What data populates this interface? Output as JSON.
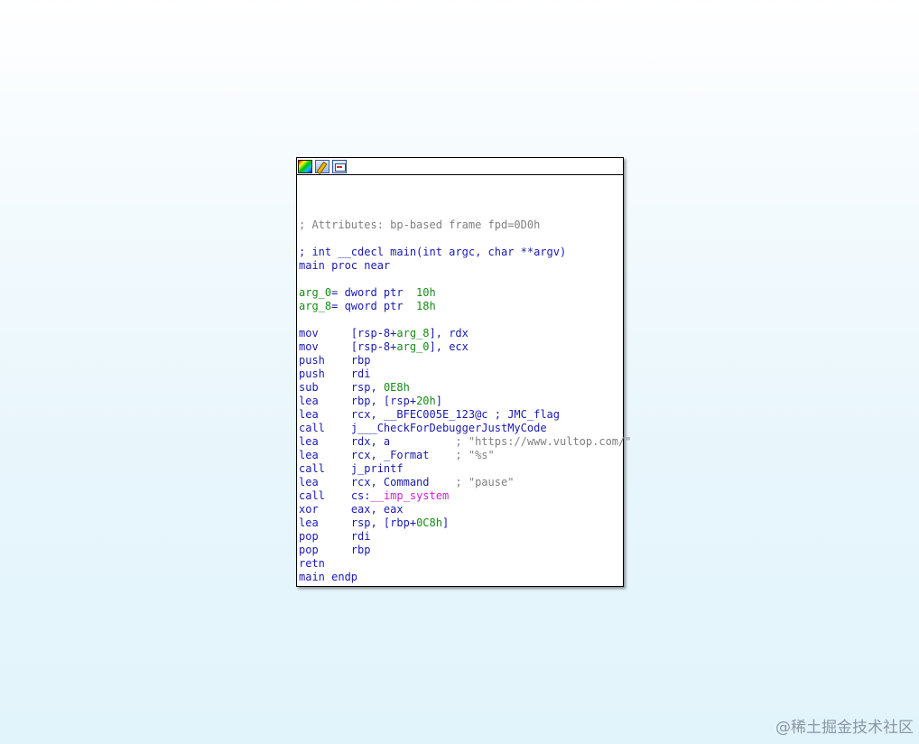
{
  "toolbar": {
    "icons": [
      "color-palette-icon",
      "rename-icon",
      "graph-view-icon"
    ]
  },
  "listing": {
    "attributes": "; Attributes: bp-based frame fpd=0D0h",
    "signature": "; int __cdecl main(int argc, char **argv)",
    "proc_start": "main proc near",
    "arg0_name": "arg_0",
    "arg0_decl": "= dword ptr  ",
    "arg0_val": "10h",
    "arg8_name": "arg_8",
    "arg8_decl": "= qword ptr  ",
    "arg8_val": "18h",
    "instructions": [
      {
        "mnem": "mov",
        "a": "[rsp-8+",
        "b": "arg_8",
        "c": "], rdx"
      },
      {
        "mnem": "mov",
        "a": "[rsp-8+",
        "b": "arg_0",
        "c": "], ecx"
      },
      {
        "mnem": "push",
        "a": "rbp"
      },
      {
        "mnem": "push",
        "a": "rdi"
      },
      {
        "mnem": "sub",
        "a": "rsp, ",
        "b": "0E8h"
      },
      {
        "mnem": "lea",
        "a": "rbp, [rsp+",
        "b": "20h",
        "c": "]"
      },
      {
        "mnem": "lea",
        "a": "rcx, __BFEC005E_123@c ; JMC_flag"
      },
      {
        "mnem": "call",
        "a": "j___CheckForDebuggerJustMyCode"
      },
      {
        "mnem": "lea",
        "a": "rdx, a          ",
        "cmt": "; \"https://www.vultop.com/\""
      },
      {
        "mnem": "lea",
        "a": "rcx, _Format    ",
        "cmt": "; \"%s\""
      },
      {
        "mnem": "call",
        "a": "j_printf"
      },
      {
        "mnem": "lea",
        "a": "rcx, Command    ",
        "cmt": "; \"pause\""
      },
      {
        "mnem": "call",
        "a": "cs:",
        "imp": "__imp_system"
      },
      {
        "mnem": "xor",
        "a": "eax, eax"
      },
      {
        "mnem": "lea",
        "a": "rsp, [rbp+",
        "b": "0C8h",
        "c": "]"
      },
      {
        "mnem": "pop",
        "a": "rdi"
      },
      {
        "mnem": "pop",
        "a": "rbp"
      },
      {
        "mnem": "retn"
      }
    ],
    "proc_end": "main endp"
  },
  "watermark": "@稀土掘金技术社区"
}
